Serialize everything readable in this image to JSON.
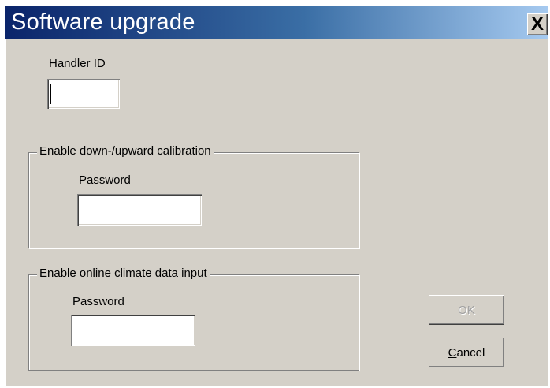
{
  "window": {
    "title": "Software upgrade",
    "close_label": "X"
  },
  "handler": {
    "label": "Handler ID",
    "value": ""
  },
  "calibration_group": {
    "legend": "Enable down-/upward calibration",
    "password_label": "Password",
    "password_value": ""
  },
  "climate_group": {
    "legend": "Enable online climate data input",
    "password_label": "Password",
    "password_value": ""
  },
  "buttons": {
    "ok_label": "OK",
    "ok_enabled": false,
    "cancel_label": "Cancel"
  },
  "colors": {
    "title_gradient_start": "#0a246a",
    "title_gradient_end": "#a6caf0",
    "dialog_face": "#d4d0c8"
  }
}
